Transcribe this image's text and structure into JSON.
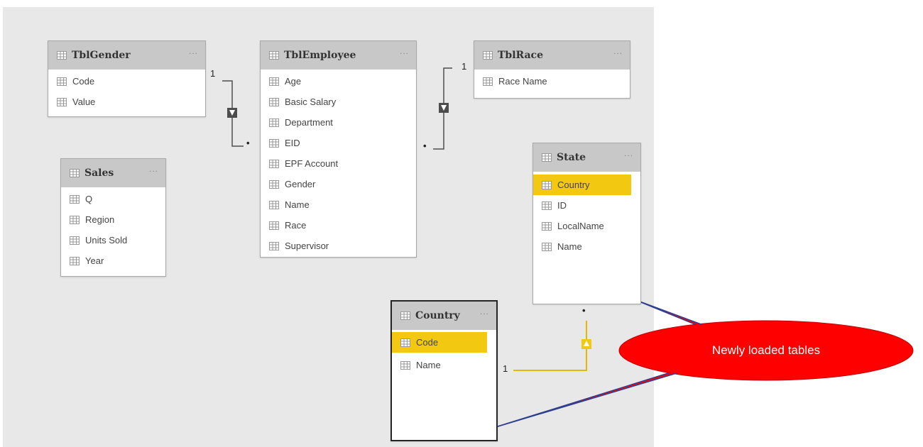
{
  "tables": {
    "gender": {
      "title": "TblGender",
      "more": "...",
      "fields": [
        "Code",
        "Value"
      ]
    },
    "employee": {
      "title": "TblEmployee",
      "more": "...",
      "fields": [
        "Age",
        "Basic Salary",
        "Department",
        "EID",
        "EPF Account",
        "Gender",
        "Name",
        "Race",
        "Supervisor"
      ]
    },
    "race": {
      "title": "TblRace",
      "more": "...",
      "fields": [
        "Race Name"
      ]
    },
    "sales": {
      "title": "Sales",
      "more": "...",
      "fields": [
        "Q",
        "Region",
        "Units Sold",
        "Year"
      ]
    },
    "state": {
      "title": "State",
      "more": "...",
      "fields": [
        "Country",
        "ID",
        "LocalName",
        "Name"
      ],
      "highlighted_field": "Country"
    },
    "country": {
      "title": "Country",
      "more": "...",
      "fields": [
        "Code",
        "Name"
      ],
      "highlighted_field": "Code"
    }
  },
  "relationships": {
    "gender_employee": {
      "one_label": "1",
      "many_label": "•"
    },
    "race_employee": {
      "one_label": "1",
      "many_label": "•"
    },
    "country_state": {
      "one_label": "1",
      "many_label": "•"
    }
  },
  "callout": {
    "text": "Newly loaded tables",
    "color": "#ff0000"
  },
  "colors": {
    "highlight": "#f2c811",
    "canvas": "#e8e8e8",
    "header": "#c8c8c8",
    "relationship": "#4d4d4d"
  }
}
